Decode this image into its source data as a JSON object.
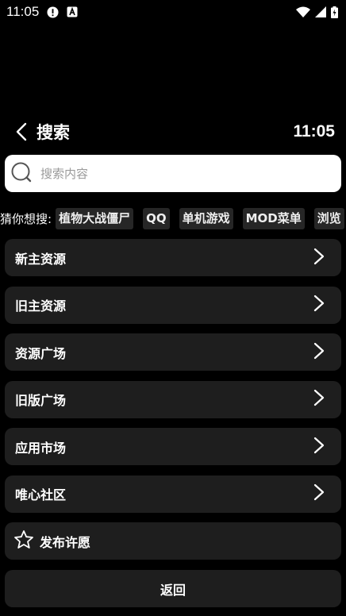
{
  "status_bar": {
    "time": "11:05",
    "icons": [
      "alert-icon",
      "a-badge-icon",
      "wifi-icon",
      "signal-icon",
      "battery-icon"
    ]
  },
  "header": {
    "back_icon": "chevron-left-icon",
    "title": "搜索",
    "time": "11:05"
  },
  "search": {
    "placeholder": "搜索内容",
    "value": ""
  },
  "suggestions": {
    "label": "猜你想搜:",
    "chips": [
      "植物大战僵尸",
      "QQ",
      "单机游戏",
      "MOD菜单",
      "浏览"
    ]
  },
  "menu": {
    "items": [
      {
        "label": "新主资源"
      },
      {
        "label": "旧主资源"
      },
      {
        "label": "资源广场"
      },
      {
        "label": "旧版广场"
      },
      {
        "label": "应用市场"
      },
      {
        "label": "唯心社区"
      }
    ]
  },
  "wish": {
    "icon": "star-icon",
    "label": "发布许愿"
  },
  "back_button": {
    "label": "返回"
  },
  "colors": {
    "background": "#000000",
    "card": "#1e1e1e",
    "chip": "#262626",
    "search_bg": "#ffffff"
  }
}
